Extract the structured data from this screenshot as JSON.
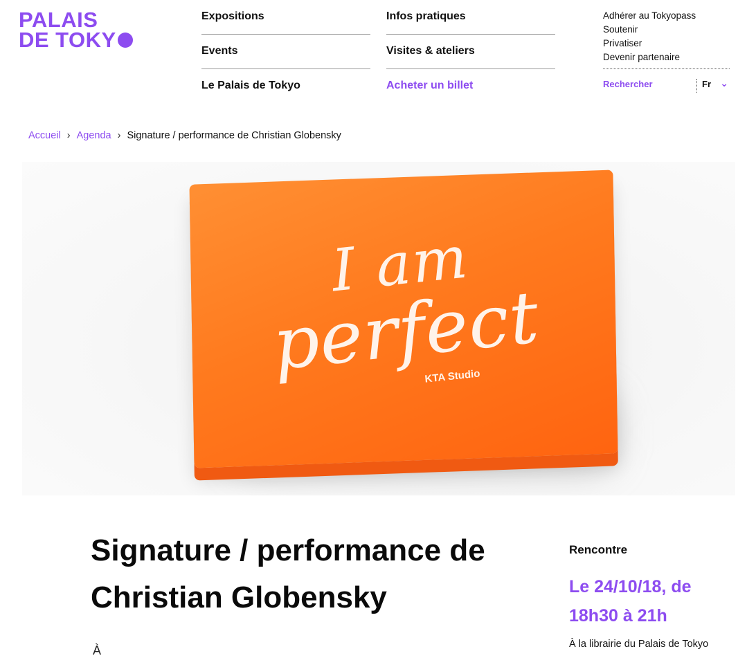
{
  "logo": {
    "line1": "PALAIS",
    "line2": "DE TOKY"
  },
  "nav": {
    "col1": [
      "Expositions",
      "Events",
      "Le Palais de Tokyo"
    ],
    "col2": [
      "Infos pratiques",
      "Visites & ateliers",
      "Acheter un billet"
    ]
  },
  "utility": {
    "links": [
      "Adhérer au Tokyopass",
      "Soutenir",
      "Privatiser",
      "Devenir partenaire"
    ],
    "search": "Rechercher",
    "lang": "Fr"
  },
  "breadcrumb": {
    "home": "Accueil",
    "section": "Agenda",
    "current": "Signature / performance de Christian Globensky"
  },
  "hero": {
    "line1": "I am",
    "line2": "perfect",
    "brand": "KTA Studio"
  },
  "event": {
    "title": "Signature / performance de Christian Globensky",
    "type": "Rencontre",
    "date": "Le 24/10/18, de 18h30 à 21h",
    "place": "À la librairie du Palais de Tokyo",
    "fragment": "À"
  },
  "colors": {
    "accent": "#8d4cf0",
    "orange": "#ff7a1e"
  }
}
